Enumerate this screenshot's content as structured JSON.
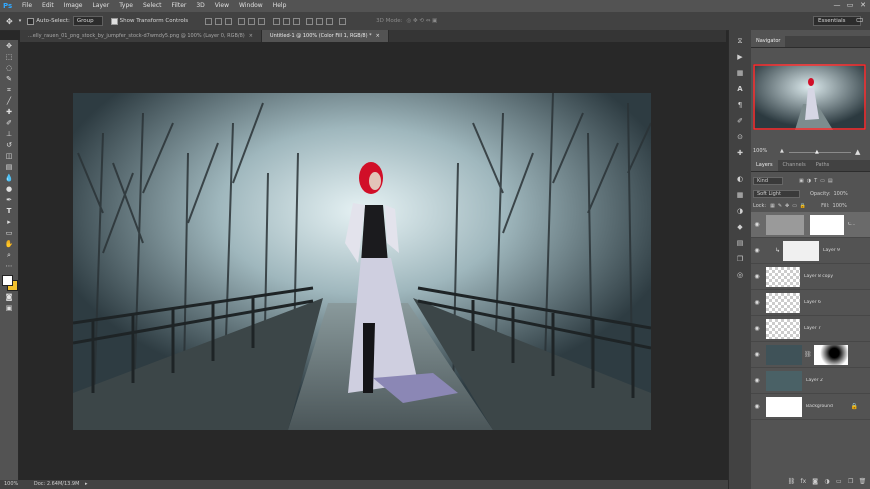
{
  "app": {
    "logo": "Ps"
  },
  "menu": [
    "File",
    "Edit",
    "Image",
    "Layer",
    "Type",
    "Select",
    "Filter",
    "3D",
    "View",
    "Window",
    "Help"
  ],
  "window_controls": {
    "minimize": "—",
    "maximize": "▭",
    "close": "✕"
  },
  "options": {
    "auto_select_label": "Auto-Select:",
    "auto_select_value": "Group",
    "show_transform_label": "Show Transform Controls",
    "mode_3d_label": "3D Mode:",
    "workspace": "Essentials"
  },
  "tabs": [
    {
      "label": "...elly_rauen_01_png_stock_by_jumpfer_stock-d7wmdy5.png @ 100% (Layer 0, RGB/8)",
      "close": "×"
    },
    {
      "label": "Untitled-1 @ 100% (Color Fill 1, RGB/8) *",
      "close": "×"
    }
  ],
  "status": {
    "zoom": "100%",
    "doc": "Doc: 2.64M/13.9M"
  },
  "navigator": {
    "title": "Navigator",
    "zoom": "100%"
  },
  "layers_panel": {
    "tabs": [
      "Layers",
      "Channels",
      "Paths"
    ],
    "kind_filter": "Kind",
    "blend_mode": "Soft Light",
    "opacity_label": "Opacity:",
    "opacity_value": "100%",
    "lock_label": "Lock:",
    "fill_label": "Fill:",
    "fill_value": "100%",
    "layers": [
      {
        "name": "C...",
        "type": "adjustment"
      },
      {
        "name": "Layer 9",
        "type": "clipped"
      },
      {
        "name": "Layer 8 copy",
        "type": "pixel"
      },
      {
        "name": "Layer 6",
        "type": "pixel"
      },
      {
        "name": "Layer 7",
        "type": "pixel"
      },
      {
        "name": "",
        "type": "masked"
      },
      {
        "name": "Layer 2",
        "type": "pixel"
      },
      {
        "name": "Background",
        "type": "background"
      }
    ]
  },
  "colors": {
    "accent": "#31a8ff",
    "fg": "#ffffff",
    "bg": "#f2c12e",
    "selection": "#6a6a6a"
  }
}
